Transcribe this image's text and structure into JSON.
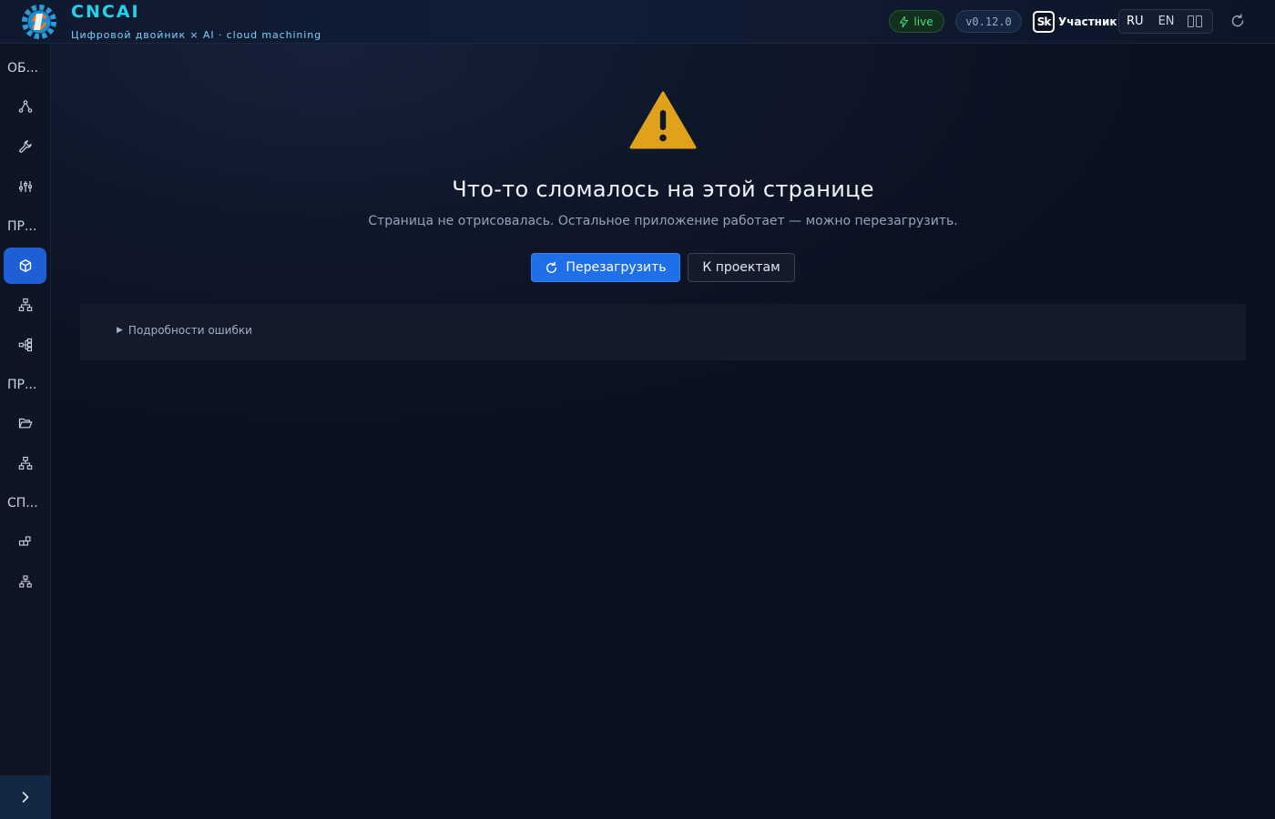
{
  "header": {
    "brand_title": "CNCAI",
    "brand_subtitle": "Цифровой двойник × AI · cloud machining",
    "live_label": "live",
    "version": "v0.12.0",
    "sk_badge": "Sk",
    "sk_label": "Участник",
    "lang_ru": "RU",
    "lang_en": "EN"
  },
  "sidebar": {
    "sections": [
      "ОБ...",
      "ПР...",
      "ПР...",
      "СП..."
    ],
    "items": [
      {
        "icon": "network-icon"
      },
      {
        "icon": "wrench-icon"
      },
      {
        "icon": "sliders-icon"
      },
      {
        "icon": "cube-icon",
        "active": true
      },
      {
        "icon": "hierarchy-icon"
      },
      {
        "icon": "tree-icon"
      },
      {
        "icon": "folder-open-icon"
      },
      {
        "icon": "hierarchy-icon"
      },
      {
        "icon": "blocks-icon"
      },
      {
        "icon": "org-chart-icon"
      }
    ]
  },
  "main": {
    "error_title": "Что-то сломалось на этой странице",
    "error_subtitle": "Страница не отрисовалась. Остальное приложение работает — можно перезагрузить.",
    "reload_label": "Перезагрузить",
    "projects_label": "К проектам",
    "details_label": "Подробности ошибки"
  },
  "colors": {
    "accent": "#1f6fe8",
    "brand": "#22d3ee",
    "warning": "#e0a21a",
    "live": "#4ade80"
  }
}
